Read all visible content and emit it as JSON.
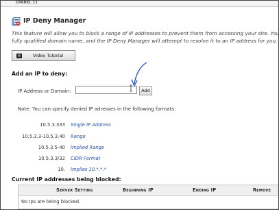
{
  "header": {
    "brand": "CPANEL 11"
  },
  "page": {
    "title": "IP Deny Manager",
    "intro_line1": "This feature will allow you to block a range of IP addresses to prevent them from accessing your site. You",
    "intro_line2": "fully qualified domain name, and the IP Deny Manager will attempt to resolve it to an IP address for you."
  },
  "video_button": {
    "label": "Video Tutorial"
  },
  "add_section": {
    "heading": "Add an IP to deny:",
    "field_label": "IP Address or Domain:",
    "field_value": "",
    "add_label": "Add"
  },
  "formats": {
    "note": "Note: You can specify denied IP adresses in the following formats:",
    "rows": [
      {
        "ip": "10.5.3.333",
        "desc": "Single IP Address"
      },
      {
        "ip": "10.5.3.3-10.5.3.40",
        "desc": "Range"
      },
      {
        "ip": "10.5.3.5-40",
        "desc": "Implied Range"
      },
      {
        "ip": "10.5.3.3/32",
        "desc": "CIDR Format"
      },
      {
        "ip": "10.",
        "desc": "Implies 10.*.*.*"
      }
    ]
  },
  "blocked": {
    "heading": "Current IP addresses being blocked:",
    "columns": [
      "Server Setting",
      "Beginning IP",
      "Ending IP",
      "Remove"
    ],
    "empty_message": "No Ips are being blocked."
  },
  "colors": {
    "link_blue": "#2a4fa8",
    "annotation_arrow": "#1e4fd0"
  },
  "icons": {
    "title_icon": "ip-deny-manager-icon",
    "video_icon": "video-camera-icon"
  }
}
